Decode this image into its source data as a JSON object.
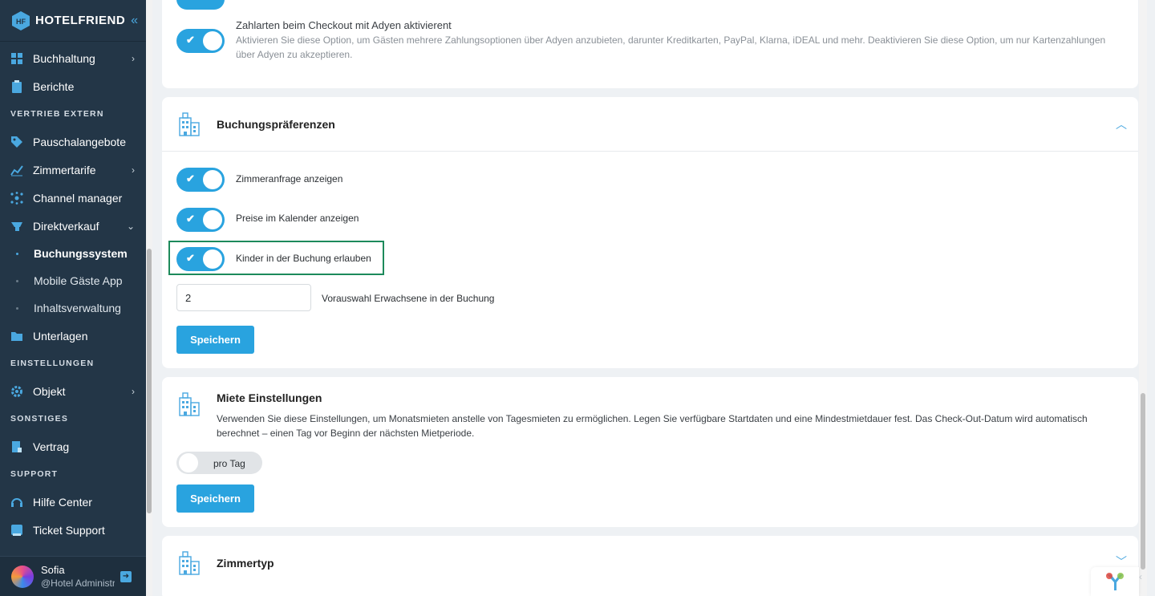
{
  "brand": {
    "name": "HOTELFRIEND",
    "mark": "HF",
    "collapse_icon": "double-chevron-left"
  },
  "sidebar": {
    "items": [
      {
        "label": "Buchhaltung",
        "icon": "accounting-icon",
        "has_chevron": true
      },
      {
        "label": "Berichte",
        "icon": "reports-icon"
      }
    ],
    "section_vertrieb": "VERTRIEB EXTERN",
    "vertrieb_items": [
      {
        "label": "Pauschalangebote",
        "icon": "tag-icon"
      },
      {
        "label": "Zimmertarife",
        "icon": "chart-icon",
        "has_chevron": true
      },
      {
        "label": "Channel manager",
        "icon": "channel-icon"
      },
      {
        "label": "Direktverkauf",
        "icon": "cart-icon",
        "expanded": true
      }
    ],
    "direktverkauf_sub": [
      {
        "label": "Buchungssystem",
        "active": true
      },
      {
        "label": "Mobile Gäste App"
      },
      {
        "label": "Inhaltsverwaltung"
      }
    ],
    "unterlagen": "Unterlagen",
    "section_einstellungen": "EINSTELLUNGEN",
    "objekt": "Objekt",
    "section_sonstiges": "SONSTIGES",
    "vertrag": "Vertrag",
    "section_support": "SUPPORT",
    "hilfe": "Hilfe Center",
    "ticket": "Ticket Support"
  },
  "user": {
    "name": "Sofia",
    "role": "@Hotel Administr"
  },
  "adyen": {
    "title": "Zahlarten beim Checkout mit Adyen aktivierent",
    "description": "Aktivieren Sie diese Option, um Gästen mehrere Zahlungsoptionen über Adyen anzubieten, darunter Kreditkarten, PayPal, Klarna, iDEAL und mehr. Deaktivieren Sie diese Option, um nur Kartenzahlungen über Adyen zu akzeptieren.",
    "enabled": true
  },
  "booking_prefs": {
    "title": "Buchungspräferenzen",
    "toggles": [
      {
        "label": "Zimmeranfrage anzeigen",
        "enabled": true
      },
      {
        "label": "Preise im Kalender anzeigen",
        "enabled": true
      },
      {
        "label": "Kinder in der Buchung erlauben",
        "enabled": true
      }
    ],
    "adults_value": "2",
    "adults_label": "Vorauswahl Erwachsene in der Buchung",
    "save_label": "Speichern"
  },
  "rent": {
    "title": "Miete Einstellungen",
    "description": "Verwenden Sie diese Einstellungen, um Monatsmieten anstelle von Tagesmieten zu ermöglichen. Legen Sie verfügbare Startdaten und eine Mindestmietdauer fest. Das Check-Out-Datum wird automatisch berechnet – einen Tag vor Beginn der nächsten Mietperiode.",
    "toggle_label": "pro Tag",
    "enabled": false,
    "save_label": "Speichern"
  },
  "room_type": {
    "title": "Zimmertyp"
  },
  "colors": {
    "accent": "#29a3df",
    "sidebar": "#233647",
    "highlight": "#1d8a5b"
  }
}
